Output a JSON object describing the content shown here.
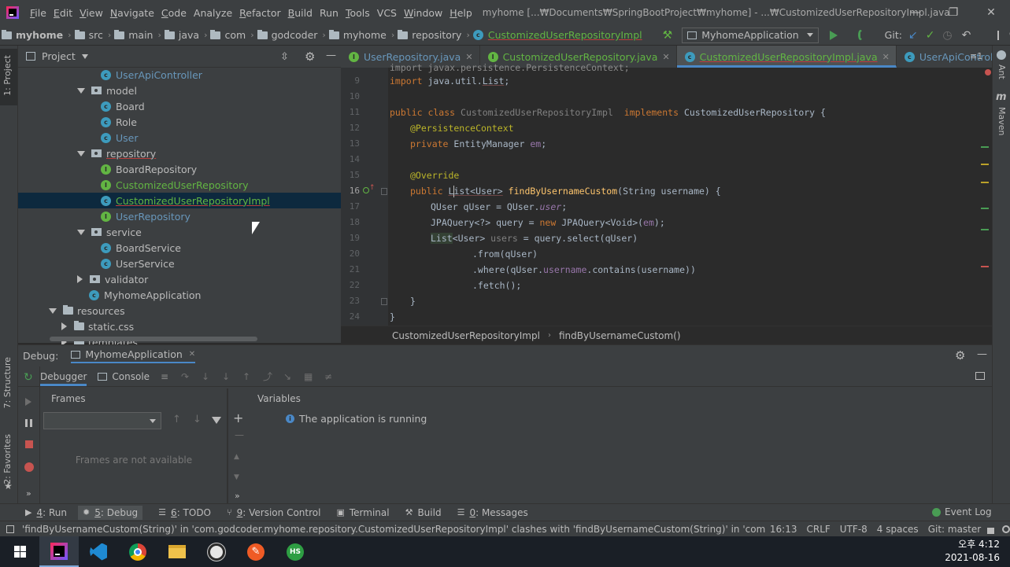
{
  "menu": {
    "items": [
      {
        "u": "F",
        "rest": "ile"
      },
      {
        "u": "E",
        "rest": "dit"
      },
      {
        "u": "V",
        "rest": "iew"
      },
      {
        "u": "N",
        "rest": "avigate"
      },
      {
        "u": "C",
        "rest": "ode"
      },
      {
        "u": "",
        "rest": "Analyze"
      },
      {
        "u": "R",
        "rest": "efactor"
      },
      {
        "u": "B",
        "rest": "uild"
      },
      {
        "u": "",
        "rest": "Run"
      },
      {
        "u": "T",
        "rest": "ools"
      },
      {
        "u": "",
        "rest": "VCS"
      },
      {
        "u": "W",
        "rest": "indow"
      },
      {
        "u": "H",
        "rest": "elp"
      }
    ],
    "window_title": "myhome [...₩Documents₩SpringBootProject₩myhome] - ...₩CustomizedUserRepositoryImpl.java"
  },
  "navbar": {
    "crumbs": [
      "myhome",
      "src",
      "main",
      "java",
      "com",
      "godcoder",
      "myhome",
      "repository"
    ],
    "current_file": "CustomizedUserRepositoryImpl",
    "run_config": "MyhomeApplication",
    "git_label": "Git:"
  },
  "left_strip": {
    "project_tab": "1: Project",
    "structure_tab": "7: Structure",
    "favorites_tab": "2: Favorites"
  },
  "right_strip": {
    "ant_tab": "Ant",
    "maven_tab": "Maven"
  },
  "project": {
    "title": "Project",
    "tree": [
      {
        "label": "UserApiController",
        "kind": "class"
      },
      {
        "label": "model",
        "kind": "package-open"
      },
      {
        "label": "Board",
        "kind": "class"
      },
      {
        "label": "Role",
        "kind": "class"
      },
      {
        "label": "User",
        "kind": "class"
      },
      {
        "label": "repository",
        "kind": "package-open"
      },
      {
        "label": "BoardRepository",
        "kind": "interface"
      },
      {
        "label": "CustomizedUserRepository",
        "kind": "interface"
      },
      {
        "label": "CustomizedUserRepositoryImpl",
        "kind": "class"
      },
      {
        "label": "UserRepository",
        "kind": "interface"
      },
      {
        "label": "service",
        "kind": "package-open"
      },
      {
        "label": "BoardService",
        "kind": "class"
      },
      {
        "label": "UserService",
        "kind": "class"
      },
      {
        "label": "validator",
        "kind": "package-closed"
      },
      {
        "label": "MyhomeApplication",
        "kind": "app"
      },
      {
        "label": "resources",
        "kind": "folder-open"
      },
      {
        "label": "static.css",
        "kind": "folder-closed"
      },
      {
        "label": "templates",
        "kind": "folder-closed"
      }
    ]
  },
  "editor": {
    "tabs": [
      {
        "label": "UserRepository.java",
        "kind": "interface"
      },
      {
        "label": "CustomizedUserRepository.java",
        "kind": "interface"
      },
      {
        "label": "CustomizedUserRepositoryImpl.java",
        "kind": "class"
      },
      {
        "label": "UserApiController.java",
        "kind": "class"
      }
    ],
    "tab_overflow": "≡1",
    "line_numbers": [
      "9",
      "10",
      "11",
      "12",
      "13",
      "14",
      "15",
      "16",
      "17",
      "18",
      "19",
      "20",
      "21",
      "22",
      "23",
      "24"
    ],
    "top_partial_line": "import javax.persistence.PersistenceContext;",
    "breadcrumb": {
      "class": "CustomizedUserRepositoryImpl",
      "method": "findByUsernameCustom()"
    }
  },
  "debug": {
    "label": "Debug:",
    "session": "MyhomeApplication",
    "tab_debugger": "Debugger",
    "tab_console": "Console",
    "frames_title": "Frames",
    "variables_title": "Variables",
    "frames_empty": "Frames are not available",
    "running_message": "The application is running"
  },
  "bottom_tools": [
    {
      "n": "4",
      "label": ": Run"
    },
    {
      "n": "5",
      "label": ": Debug"
    },
    {
      "n": "6",
      "label": ": TODO"
    },
    {
      "n": "9",
      "label": ": Version Control"
    },
    {
      "n": "",
      "label": "Terminal"
    },
    {
      "n": "",
      "label": "Build"
    },
    {
      "n": "0",
      "label": ": Messages"
    }
  ],
  "event_log": "Event Log",
  "status": {
    "message": "'findByUsernameCustom(String)' in 'com.godcoder.myhome.repository.CustomizedUserRepositoryImpl' clashes with 'findByUsernameCustom(String)' in 'com.godcoder.myh...",
    "position": "16:13",
    "line_sep": "CRLF",
    "encoding": "UTF-8",
    "indent": "4 spaces",
    "git_branch": "Git: master"
  },
  "taskbar": {
    "time": "오후 4:12",
    "date": "2021-08-16",
    "hs_label": "HS"
  },
  "colors": {
    "accent": "#4a88c7",
    "selection": "#0d293e",
    "run_green": "#499c54",
    "stop_red": "#c75450"
  }
}
